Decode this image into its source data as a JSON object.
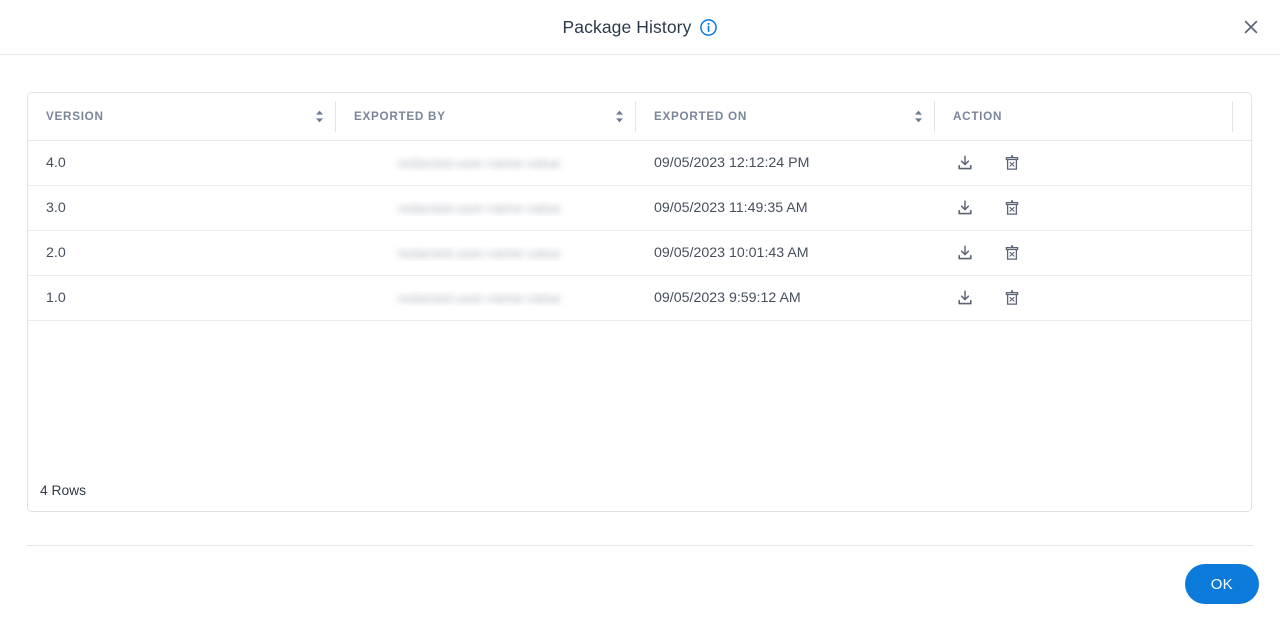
{
  "dialog": {
    "title": "Package History",
    "info_icon_name": "info-icon",
    "close_icon_name": "close-icon",
    "ok_label": "OK",
    "accent_color": "#0b7ada",
    "header_text_color": "#7a8699",
    "body_text_color": "#464f5c"
  },
  "table": {
    "columns": [
      {
        "label": "VERSION",
        "sortable": true
      },
      {
        "label": "EXPORTED BY",
        "sortable": true
      },
      {
        "label": "EXPORTED ON",
        "sortable": true
      },
      {
        "label": "ACTION",
        "sortable": false
      }
    ],
    "rows": [
      {
        "version": "4.0",
        "exported_by": "redacted-user-name-value",
        "exported_by_redacted": true,
        "exported_on": "09/05/2023 12:12:24 PM",
        "actions": [
          "download-icon",
          "delete-icon"
        ]
      },
      {
        "version": "3.0",
        "exported_by": "redacted-user-name-value",
        "exported_by_redacted": true,
        "exported_on": "09/05/2023 11:49:35 AM",
        "actions": [
          "download-icon",
          "delete-icon"
        ]
      },
      {
        "version": "2.0",
        "exported_by": "redacted-user-name-value",
        "exported_by_redacted": true,
        "exported_on": "09/05/2023 10:01:43 AM",
        "actions": [
          "download-icon",
          "delete-icon"
        ]
      },
      {
        "version": "1.0",
        "exported_by": "redacted-user-name-value",
        "exported_by_redacted": true,
        "exported_on": "09/05/2023 9:59:12 AM",
        "actions": [
          "download-icon",
          "delete-icon"
        ]
      }
    ],
    "row_count_label": "4 Rows",
    "action_icons": {
      "download": "download-icon",
      "delete": "delete-icon"
    },
    "sort_icon": "sort-arrows-icon"
  }
}
